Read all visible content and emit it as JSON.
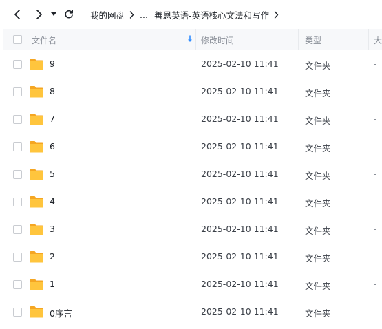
{
  "toolbar": {
    "back_icon": "chevron-left-icon",
    "forward_icon": "chevron-right-icon",
    "history_icon": "caret-down-icon",
    "refresh_icon": "refresh-icon",
    "breadcrumbs": [
      "我的网盘",
      "...",
      "善恩英语-英语核心文法和写作"
    ]
  },
  "columns": {
    "name": "文件名",
    "modified": "修改时间",
    "type": "类型",
    "size": "大"
  },
  "files": [
    {
      "name": "9",
      "modified": "2025-02-10 11:41",
      "type": "文件夹",
      "size": "-"
    },
    {
      "name": "8",
      "modified": "2025-02-10 11:41",
      "type": "文件夹",
      "size": "-"
    },
    {
      "name": "7",
      "modified": "2025-02-10 11:41",
      "type": "文件夹",
      "size": "-"
    },
    {
      "name": "6",
      "modified": "2025-02-10 11:41",
      "type": "文件夹",
      "size": "-"
    },
    {
      "name": "5",
      "modified": "2025-02-10 11:41",
      "type": "文件夹",
      "size": "-"
    },
    {
      "name": "4",
      "modified": "2025-02-10 11:41",
      "type": "文件夹",
      "size": "-"
    },
    {
      "name": "3",
      "modified": "2025-02-10 11:41",
      "type": "文件夹",
      "size": "-"
    },
    {
      "name": "2",
      "modified": "2025-02-10 11:41",
      "type": "文件夹",
      "size": "-"
    },
    {
      "name": "1",
      "modified": "2025-02-10 11:41",
      "type": "文件夹",
      "size": "-"
    },
    {
      "name": "0序言",
      "modified": "2025-02-10 11:41",
      "type": "文件夹",
      "size": "-"
    }
  ],
  "colors": {
    "folder_body": "#ffc53d",
    "folder_tab": "#f5a623",
    "sort_arrow": "#2f8cff",
    "header_bg": "#f7f8fa"
  }
}
